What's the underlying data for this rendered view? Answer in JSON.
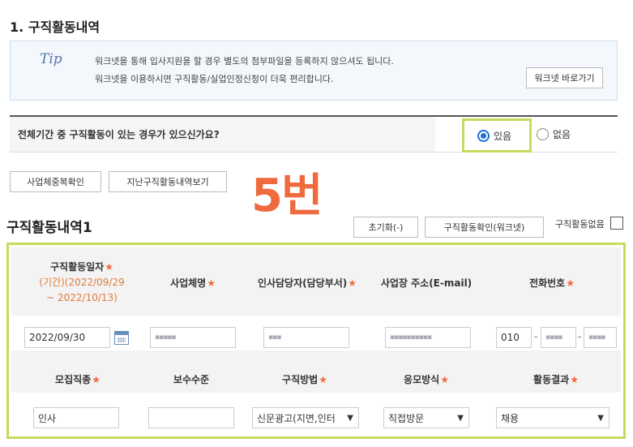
{
  "section_title": "1. 구직활동내역",
  "tip": {
    "logo": "Tip",
    "line1": "워크넷을 통해 입사지원을 할 경우 별도의 첨부파일을 등록하지 않으셔도 됩니다.",
    "line2": "워크넷을 이용하시면 구직활동/실업인정신청이 더욱 편리합니다.",
    "button": "워크넷 바로가기"
  },
  "question": {
    "text": "전체기간 중 구직활동이 있는 경우가 있으신가요?",
    "yes_label": "있음",
    "no_label": "없음",
    "selected": "yes"
  },
  "buttons": {
    "duplicate_check": "사업체중복확인",
    "previous_history": "지난구직활동내역보기",
    "reset": "초기화(-)",
    "worknet_check": "구직활동확인(워크넷)"
  },
  "annotation": "5번",
  "list": {
    "title": "구직활동내역1",
    "none_label": "구직활동없음"
  },
  "headers": {
    "date": "구직활동일자",
    "period_line1": "(기간)(2022/09/29",
    "period_line2": "~ 2022/10/13)",
    "company": "사업체명",
    "manager": "인사담당자(담당부서)",
    "address": "사업장 주소(E-mail)",
    "phone": "전화번호",
    "job": "모집직종",
    "salary": "보수수준",
    "method": "구직방법",
    "apply": "응모방식",
    "result": "활동결과",
    "required_mark": "★"
  },
  "values": {
    "date": "2022/09/30",
    "company": "▪▪▪▪▪",
    "manager": "▪▪▪",
    "address": "▪▪▪▪▪▪▪▪▪▪",
    "phone1": "010",
    "phone2": "▪▪▪▪",
    "phone3": "▪▪▪▪",
    "phone_sep": "-",
    "job": "인사",
    "salary": "",
    "method": "신문광고(지면,인터",
    "apply": "직접방문",
    "result": "채용"
  },
  "colors": {
    "highlight": "#c2dd5c",
    "accent": "#f06a3f",
    "radio": "#1f6fd6"
  }
}
